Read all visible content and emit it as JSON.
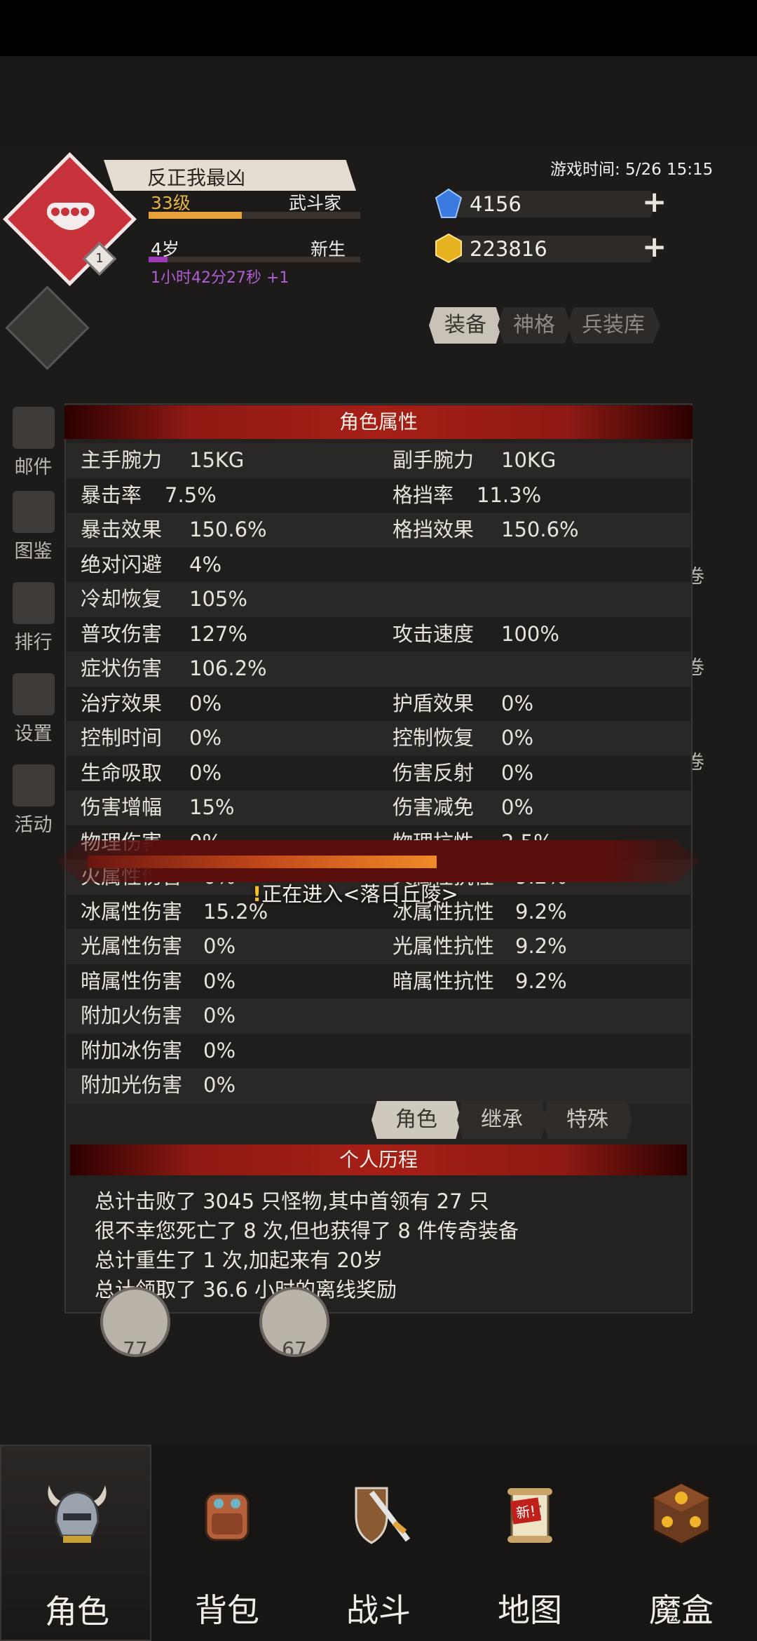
{
  "header": {
    "player_name": "反正我最凶",
    "level": "33级",
    "class": "武斗家",
    "age": "4岁",
    "age_stage": "新生",
    "timer": "1小时42分27秒 +1",
    "emblem_badge": "1",
    "level_progress": 0.44,
    "age_progress": 0.09,
    "game_time": "游戏时间: 5/26 15:15",
    "gems": "4156",
    "gold": "223816"
  },
  "right_tabs": [
    "装备",
    "神格",
    "兵装库"
  ],
  "right_side_labels": [
    "卷",
    "卷",
    "卷"
  ],
  "left_menu": [
    "邮件",
    "图鉴",
    "排行",
    "设置",
    "活动"
  ],
  "modal": {
    "title": "角色属性",
    "rows": [
      [
        {
          "label": "主手腕力",
          "value": "15KG"
        },
        {
          "label": "副手腕力",
          "value": "10KG"
        }
      ],
      [
        {
          "label": "暴击率",
          "value": "7.5%"
        },
        {
          "label": "格挡率",
          "value": "11.3%"
        }
      ],
      [
        {
          "label": "暴击效果",
          "value": "150.6%"
        },
        {
          "label": "格挡效果",
          "value": "150.6%"
        }
      ],
      [
        {
          "label": "绝对闪避",
          "value": "4%"
        }
      ],
      [
        {
          "label": "冷却恢复",
          "value": "105%"
        }
      ],
      [
        {
          "label": "普攻伤害",
          "value": "127%"
        },
        {
          "label": "攻击速度",
          "value": "100%"
        }
      ],
      [
        {
          "label": "症状伤害",
          "value": "106.2%"
        }
      ],
      [
        {
          "label": "治疗效果",
          "value": "0%"
        },
        {
          "label": "护盾效果",
          "value": "0%"
        }
      ],
      [
        {
          "label": "控制时间",
          "value": "0%"
        },
        {
          "label": "控制恢复",
          "value": "0%"
        }
      ],
      [
        {
          "label": "生命吸取",
          "value": "0%"
        },
        {
          "label": "伤害反射",
          "value": "0%"
        }
      ],
      [
        {
          "label": "伤害增幅",
          "value": "15%"
        },
        {
          "label": "伤害减免",
          "value": "0%"
        }
      ],
      [
        {
          "label": "物理伤害",
          "value": "0%"
        },
        {
          "label": "物理抗性",
          "value": "2.5%"
        }
      ],
      [
        {
          "label": "火属性伤害",
          "value": "0%"
        },
        {
          "label": "火属性抗性",
          "value": "9.2%"
        }
      ],
      [
        {
          "label": "冰属性伤害",
          "value": "15.2%"
        },
        {
          "label": "冰属性抗性",
          "value": "9.2%"
        }
      ],
      [
        {
          "label": "光属性伤害",
          "value": "0%"
        },
        {
          "label": "光属性抗性",
          "value": "9.2%"
        }
      ],
      [
        {
          "label": "暗属性伤害",
          "value": "0%"
        },
        {
          "label": "暗属性抗性",
          "value": "9.2%"
        }
      ],
      [
        {
          "label": "附加火伤害",
          "value": "0%"
        }
      ],
      [
        {
          "label": "附加冰伤害",
          "value": "0%"
        }
      ],
      [
        {
          "label": "附加光伤害",
          "value": "0%"
        }
      ]
    ],
    "tabs": [
      "角色",
      "继承",
      "特殊"
    ],
    "history_title": "个人历程",
    "history": [
      "总计击败了 3045 只怪物,其中首领有 27 只",
      "很不幸您死亡了 8 次,但也获得了 8 件传奇装备",
      "总计重生了 1 次,加起来有 20岁",
      "总计领取了 36.6 小时的离线奖励"
    ]
  },
  "loading": {
    "warn_icon": "!",
    "text": "正在进入<落日丘陵>",
    "progress": 0.59
  },
  "dials": [
    "77",
    "67"
  ],
  "nav": [
    {
      "label": "角色",
      "icon": "helmet-icon"
    },
    {
      "label": "背包",
      "icon": "backpack-icon"
    },
    {
      "label": "战斗",
      "icon": "sword-shield-icon"
    },
    {
      "label": "地图",
      "icon": "scroll-map-icon"
    },
    {
      "label": "魔盒",
      "icon": "magic-box-icon"
    }
  ],
  "nav_new_badge": "新!",
  "colors": {
    "accent_red": "#a61f16",
    "level_gold": "#e4b446",
    "timer_purple": "#b05fd2",
    "emblem_red": "#c8333b"
  }
}
